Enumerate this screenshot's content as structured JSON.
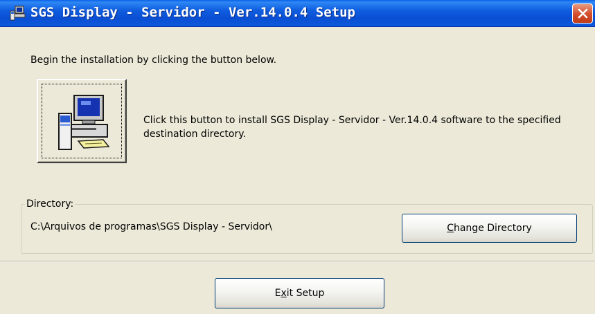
{
  "window": {
    "title": "SGS Display - Servidor - Ver.14.0.4 Setup",
    "icon": "setup-computer-icon",
    "close_icon": "close-icon"
  },
  "intro_text": "Begin the installation by clicking the button below.",
  "install": {
    "icon": "install-computer-icon",
    "description": "Click this button to install SGS Display - Servidor - Ver.14.0.4 software to the specified destination directory."
  },
  "directory": {
    "group_label": "Directory:",
    "path": "C:\\Arquivos de programas\\SGS Display - Servidor\\",
    "change_button": {
      "accel": "C",
      "rest": "hange Directory"
    }
  },
  "exit_button": {
    "pre": "E",
    "accel": "x",
    "post": "it Setup"
  },
  "colors": {
    "titlebar": "#0A4FD3",
    "face": "#ECE9D8",
    "close": "#D24C2B"
  }
}
